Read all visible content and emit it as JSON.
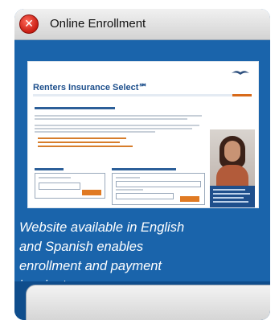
{
  "window": {
    "title": "Online Enrollment",
    "close_icon": "close-icon"
  },
  "screenshot": {
    "site_title": "Renters Insurance Select℠"
  },
  "description": [
    "Website available in English",
    "and Spanish enables",
    "enrollment and payment",
    "in minutes."
  ],
  "colors": {
    "panel": "#1a64ab",
    "header": "#d3d3d3",
    "close_button": "#c81c12",
    "accent": "#e07a23"
  }
}
